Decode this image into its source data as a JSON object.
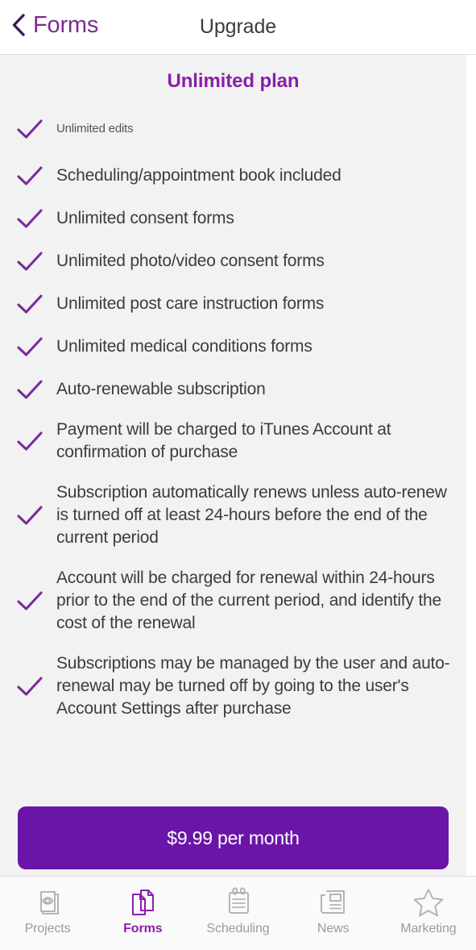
{
  "nav": {
    "back_label": "Forms",
    "back_icon": "chevron-left-icon",
    "title": "Upgrade"
  },
  "colors": {
    "accent_purple": "#8A1FA8",
    "link_purple": "#7B2D8E",
    "chevron_purple": "#3A1A5E",
    "check_purple": "#7B2A9D",
    "cta_purple": "#6B15A8",
    "content_bg": "#F2F2F2",
    "tab_inactive": "#9b9b9b"
  },
  "plan": {
    "title": "Unlimited plan",
    "features": [
      {
        "text": "Unlimited edits",
        "size": "small",
        "lines": 1
      },
      {
        "text": "Scheduling/appointment book included",
        "size": "normal",
        "lines": 1
      },
      {
        "text": "Unlimited consent forms",
        "size": "normal",
        "lines": 1
      },
      {
        "text": "Unlimited photo/video consent forms",
        "size": "normal",
        "lines": 1
      },
      {
        "text": "Unlimited post care instruction forms",
        "size": "normal",
        "lines": 1
      },
      {
        "text": "Unlimited medical conditions forms",
        "size": "normal",
        "lines": 1
      },
      {
        "text": "Auto-renewable subscription",
        "size": "normal",
        "lines": 1
      },
      {
        "text": "Payment will be charged to iTunes Account at confirmation of purchase",
        "size": "normal",
        "lines": 2
      },
      {
        "text": "Subscription automatically renews unless auto-renew is turned off at least 24-hours before the end of the current period",
        "size": "normal",
        "lines": 3
      },
      {
        "text": "Account will be charged for renewal within 24-hours prior to the end of the current period, and identify the cost of the renewal",
        "size": "normal",
        "lines": 3
      },
      {
        "text": "Subscriptions may be managed by the user and auto-renewal may be turned off by going to the user's Account Settings after purchase",
        "size": "normal",
        "lines": 3
      }
    ],
    "check_icon": "check-icon"
  },
  "cta": {
    "label": "$9.99 per month"
  },
  "tabbar": {
    "items": [
      {
        "label": "Projects",
        "icon": "projects-eye-pages-icon",
        "active": false
      },
      {
        "label": "Forms",
        "icon": "forms-pages-icon",
        "active": true
      },
      {
        "label": "Scheduling",
        "icon": "calendar-notepad-icon",
        "active": false
      },
      {
        "label": "News",
        "icon": "newspaper-icon",
        "active": false
      },
      {
        "label": "Marketing",
        "icon": "star-icon",
        "active": false
      }
    ]
  }
}
